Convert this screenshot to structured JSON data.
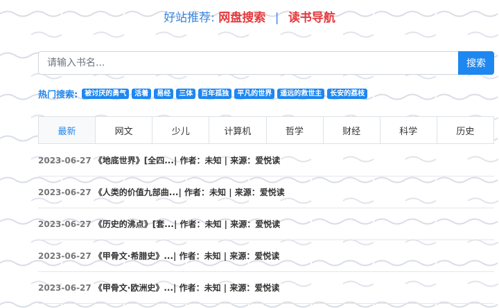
{
  "recommend": {
    "lead": "好站推荐:",
    "link1": "网盘搜索",
    "separator": "|",
    "link2": "读书导航"
  },
  "search": {
    "placeholder": "请输入书名...",
    "button_label": "搜索"
  },
  "hot": {
    "label": "热门搜索:",
    "tags": [
      "被讨厌的勇气",
      "活着",
      "易经",
      "三体",
      "百年孤独",
      "平凡的世界",
      "遥远的救世主",
      "长安的荔枝"
    ]
  },
  "tabs": [
    "最新",
    "网文",
    "少儿",
    "计算机",
    "哲学",
    "财经",
    "科学",
    "历史"
  ],
  "list": [
    {
      "date": "2023-06-27",
      "title": "《地底世界》[全四...",
      "meta": " | 作者：未知 | 来源：爱悦读"
    },
    {
      "date": "2023-06-27",
      "title": "《人类的价值九部曲...",
      "meta": " | 作者：未知 | 来源：爱悦读"
    },
    {
      "date": "2023-06-27",
      "title": "《历史的沸点》[套...",
      "meta": " | 作者：未知 | 来源：爱悦读"
    },
    {
      "date": "2023-06-27",
      "title": "《甲骨文·希腊史》...",
      "meta": " | 作者：未知 | 来源：爱悦读"
    },
    {
      "date": "2023-06-27",
      "title": "《甲骨文·欧洲史》...",
      "meta": " | 作者：未知 | 来源：爱悦读"
    }
  ],
  "colors": {
    "accent": "#1e87f0",
    "link_red": "#e4393c"
  }
}
